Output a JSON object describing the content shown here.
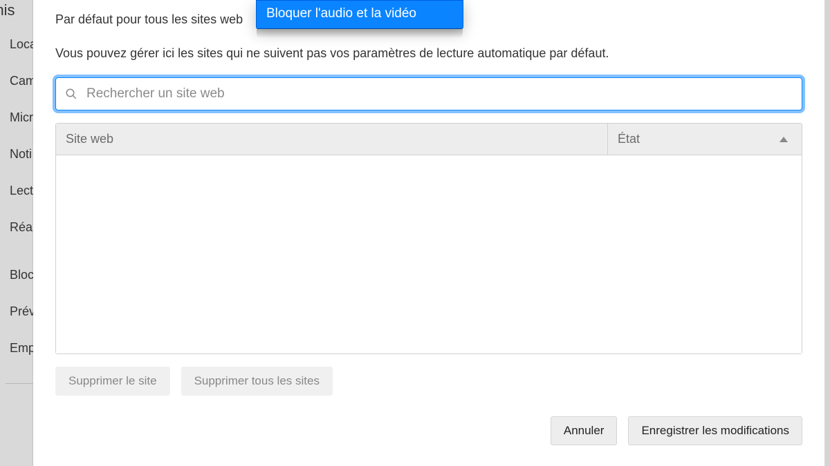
{
  "sidebar": {
    "heading": "rmis",
    "items": [
      "Loca",
      "Cam",
      "Micr",
      "Noti",
      "Lect",
      "Réa"
    ],
    "items2": [
      "Bloc",
      "Prév",
      "Emp"
    ]
  },
  "defaults": {
    "label": "Par défaut pour tous les sites web",
    "dropdown_selected": "Bloquer l'audio et la vidéo"
  },
  "hint": "Vous pouvez gérer ici les sites qui ne suivent pas vos paramètres de lecture automatique par défaut.",
  "search": {
    "placeholder": "Rechercher un site web",
    "value": ""
  },
  "table": {
    "col_site": "Site web",
    "col_etat": "État"
  },
  "buttons": {
    "remove_site": "Supprimer le site",
    "remove_all": "Supprimer tous les sites",
    "cancel": "Annuler",
    "save": "Enregistrer les modifications"
  }
}
